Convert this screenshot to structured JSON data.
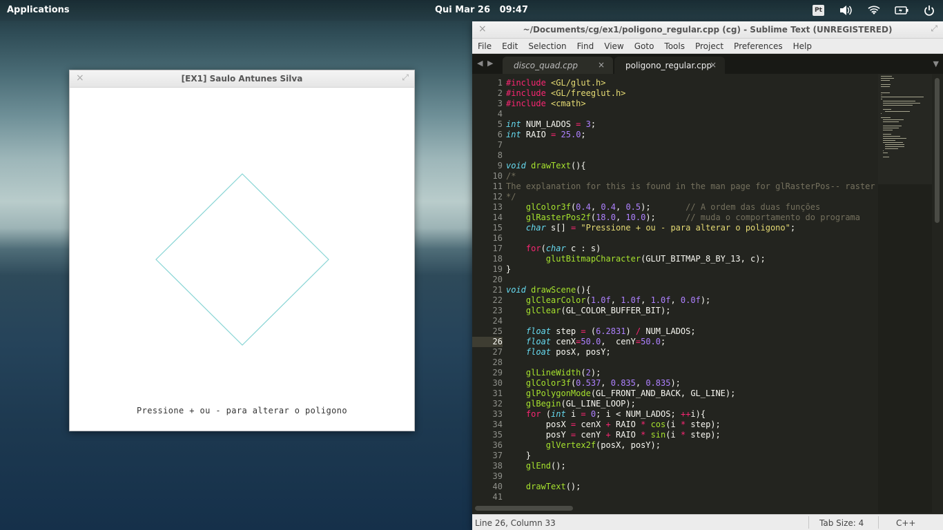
{
  "top_panel": {
    "applications_label": "Applications",
    "clock": "Qui Mar 26   09:47",
    "keyboard_layout": "Pt"
  },
  "gl_window": {
    "title": "[EX1] Saulo Antunes Silva",
    "canvas_text": "Pressione + ou - para alterar o poligono",
    "polygon_color": "#89d5d5",
    "polygon_sides": 4
  },
  "sublime": {
    "title": "~/Documents/cg/ex1/poligono_regular.cpp (cg) - Sublime Text (UNREGISTERED)",
    "menu": [
      "File",
      "Edit",
      "Selection",
      "Find",
      "View",
      "Goto",
      "Tools",
      "Project",
      "Preferences",
      "Help"
    ],
    "tabs": [
      {
        "label": "disco_quad.cpp",
        "active": false
      },
      {
        "label": "poligono_regular.cpp",
        "active": true
      }
    ],
    "current_line": 26,
    "line_numbers": [
      "1",
      "2",
      "3",
      "4",
      "5",
      "6",
      "7",
      "8",
      "9",
      "10",
      "11",
      "12",
      "13",
      "14",
      "15",
      "16",
      "17",
      "18",
      "19",
      "20",
      "21",
      "22",
      "23",
      "24",
      "25",
      "26",
      "27",
      "28",
      "29",
      "30",
      "31",
      "32",
      "33",
      "34",
      "35",
      "36",
      "37",
      "38",
      "39",
      "40",
      "41"
    ],
    "code_lines": [
      "#include <GL/glut.h>",
      "#include <GL/freeglut.h>",
      "#include <cmath>",
      "",
      "int NUM_LADOS = 3;",
      "int RAIO = 25.0;",
      "",
      "",
      "void drawText(){",
      "/*",
      "The explanation for this is found in the man page for glRasterPos-- raster ope",
      "*/",
      "    glColor3f(0.4, 0.4, 0.5);       // A ordem das duas funções",
      "    glRasterPos2f(18.0, 10.0);      // muda o comportamento do programa",
      "    char s[] = \"Pressione + ou - para alterar o poligono\";",
      "",
      "    for(char c : s)",
      "        glutBitmapCharacter(GLUT_BITMAP_8_BY_13, c);",
      "}",
      "",
      "void drawScene(){",
      "    glClearColor(1.0f, 1.0f, 1.0f, 0.0f);",
      "    glClear(GL_COLOR_BUFFER_BIT);",
      "",
      "    float step = (6.2831) / NUM_LADOS;",
      "    float cenX=50.0,  cenY=50.0;",
      "    float posX, posY;",
      "",
      "    glLineWidth(2);",
      "    glColor3f(0.537, 0.835, 0.835);",
      "    glPolygonMode(GL_FRONT_AND_BACK, GL_LINE);",
      "    glBegin(GL_LINE_LOOP);",
      "    for (int i = 0; i < NUM_LADOS; ++i){",
      "        posX = cenX + RAIO * cos(i * step);",
      "        posY = cenY + RAIO * sin(i * step);",
      "        glVertex2f(posX, posY);",
      "    }",
      "    glEnd();",
      "",
      "    drawText();",
      ""
    ],
    "status": {
      "position": "Line 26, Column 33",
      "tab_size": "Tab Size: 4",
      "syntax": "C++"
    }
  }
}
